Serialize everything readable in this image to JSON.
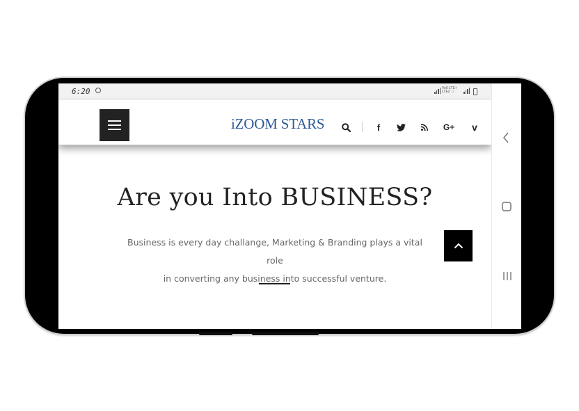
{
  "status_bar": {
    "time": "6:20",
    "network_top": "Vo0 LTE+",
    "network_bottom": "LTE2 ↓↑"
  },
  "header": {
    "logo": "iZOOM STARS",
    "menu_icon": "hamburger-icon",
    "icons": [
      "search-icon",
      "facebook-icon",
      "twitter-icon",
      "rss-icon",
      "google-plus-icon",
      "vimeo-icon"
    ],
    "facebook_glyph": "f",
    "googleplus_glyph": "G+",
    "vimeo_glyph": "v"
  },
  "hero": {
    "title": "Are you Into BUSINESS?",
    "text_line1": "Business is every day challange, Marketing & Branding plays a vital role",
    "text_line2": "in converting any business into successful venture."
  },
  "scroll_top_icon": "chevron-up-icon",
  "nav_bar": {
    "icons": [
      "back-icon",
      "home-icon",
      "recents-icon"
    ]
  },
  "colors": {
    "logo": "#2d5b96",
    "menu_button": "#222222",
    "scroll_top_button": "#000000",
    "status_bar": "#f2f2f2"
  }
}
